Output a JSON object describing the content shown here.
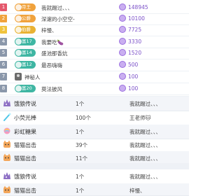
{
  "ranking": [
    {
      "rank": "1",
      "rank_color": "#e4586c",
      "badge": "帝王",
      "badge_color": "#f0a23c",
      "name": "我就踢过、、、",
      "score": "148945"
    },
    {
      "rank": "2",
      "rank_color": "#f0a23c",
      "badge": "公爵",
      "badge_color": "#f0a23c",
      "name": "深邃的小空空-",
      "score": "10100"
    },
    {
      "rank": "3",
      "rank_color": "#f0c33c",
      "badge": "伯爵",
      "badge_color": "#e9b233",
      "name": "梓慢、",
      "score": "7725"
    },
    {
      "rank": "4",
      "rank_color": "#8a97aa",
      "badge": "富17",
      "badge_color": "#3fb6a3",
      "name": "我要吃🍆",
      "score": "3330"
    },
    {
      "rank": "5",
      "rank_color": "#8a97aa",
      "badge": "富14",
      "badge_color": "#3fb6a3",
      "name": "盛池那香炕",
      "score": "1520"
    },
    {
      "rank": "6",
      "rank_color": "#8a97aa",
      "badge": "富12",
      "badge_color": "#3fb6a3",
      "name": "最恶嗨嗨",
      "score": "500"
    },
    {
      "rank": "7",
      "rank_color": "#8a97aa",
      "badge": "",
      "badge_color": "",
      "name": "神秘人",
      "score": "100"
    },
    {
      "rank": "8",
      "rank_color": "#8a97aa",
      "badge": "富20",
      "badge_color": "#3fb6a3",
      "name": "莫法披风",
      "score": "100"
    }
  ],
  "gifts": [
    {
      "name": "饿狼传说",
      "icon": "wolf-gift-icon",
      "count": "1个",
      "user": "我就踢过、、、"
    },
    {
      "name": "小荧光棒",
      "icon": "glow-stick-icon",
      "count": "100个",
      "user": "王老师🐱"
    },
    {
      "name": "彩虹糖果",
      "icon": "rainbow-candy-icon",
      "count": "1个",
      "user": "我就踢过、、、"
    },
    {
      "name": "猫猫出击",
      "icon": "cat-attack-icon",
      "count": "39个",
      "user": "我就踢过、、、"
    },
    {
      "name": "猫猫出击",
      "icon": "cat-attack-icon",
      "count": "11个",
      "user": "我就踢过、、、"
    },
    {
      "name": "饿狼传说",
      "icon": "wolf-gift-icon",
      "count": "1个",
      "user": "我就踢过、、、"
    },
    {
      "name": "猫猫出击",
      "icon": "cat-attack-icon",
      "count": "1个",
      "user": "梓慢、"
    }
  ]
}
